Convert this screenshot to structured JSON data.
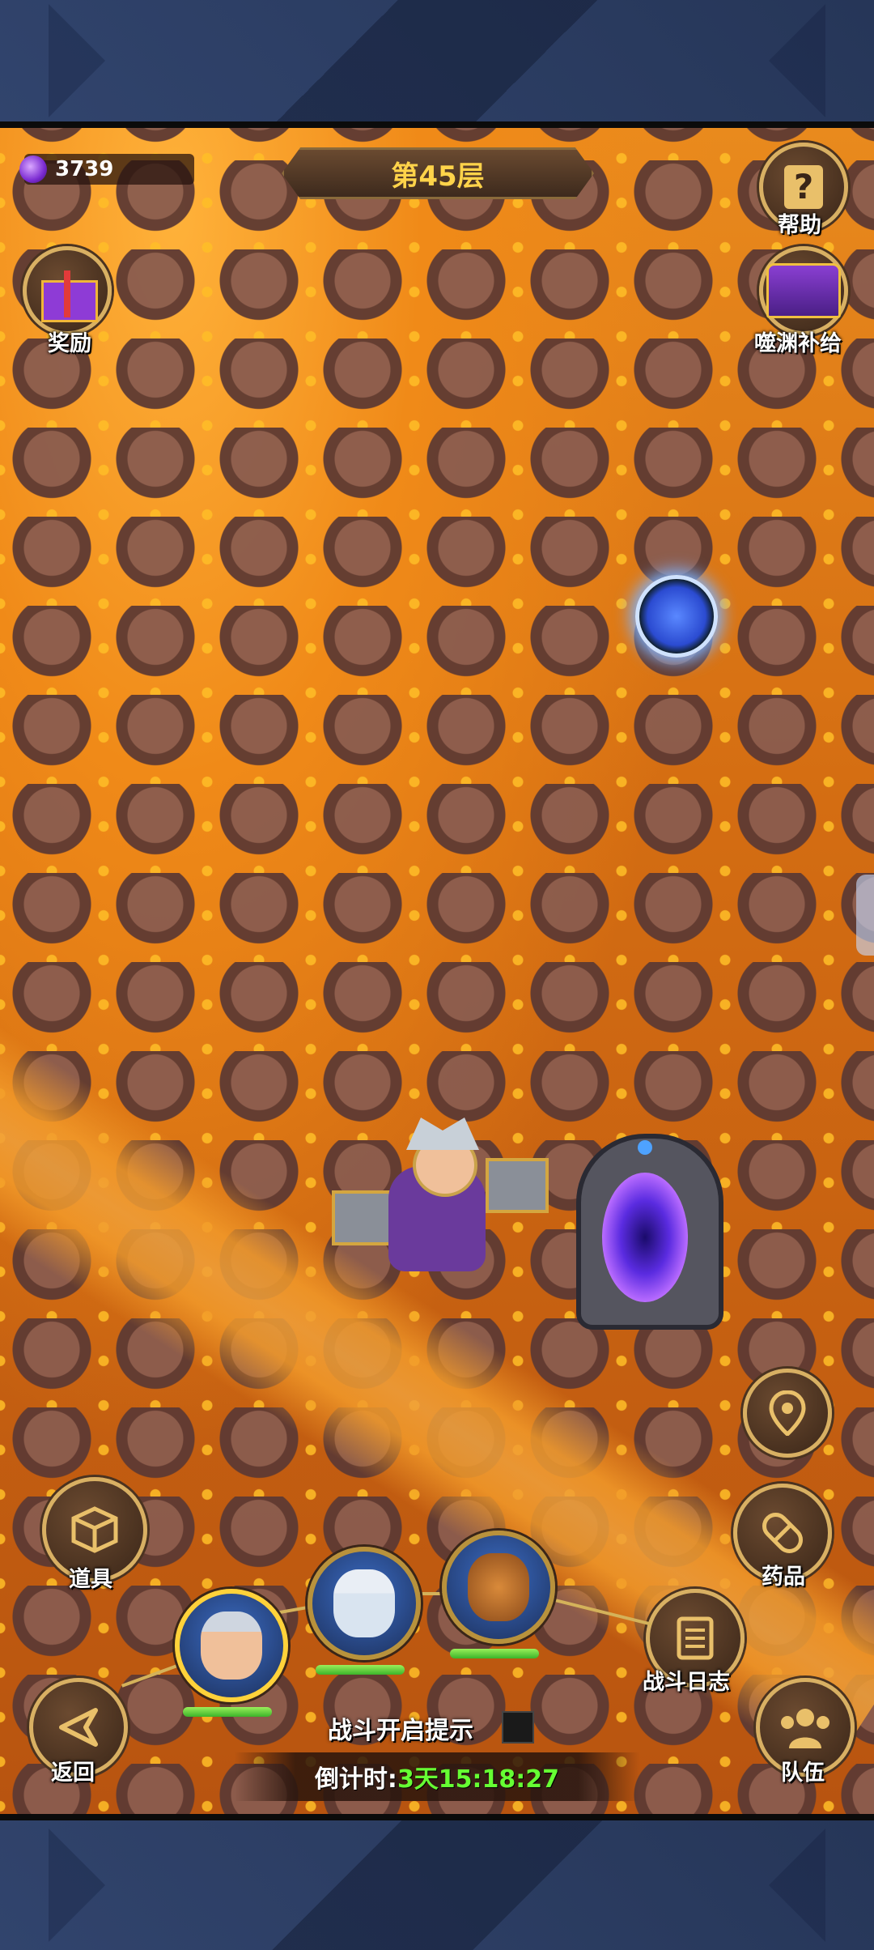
{
  "resource": {
    "icon": "purple-potion-icon",
    "amount": "3739"
  },
  "floor": {
    "title": "第45层"
  },
  "top_right": [
    {
      "label": "帮助",
      "icon": "question-icon"
    },
    {
      "label": "噬渊补给",
      "icon": "treasure-chest-icon"
    }
  ],
  "top_left": {
    "label": "奖励",
    "icon": "gift-icon"
  },
  "right_controls": {
    "locate_icon": "map-pin-icon",
    "potion_label": "药品",
    "battle_log_label": "战斗日志",
    "team_label": "队伍"
  },
  "left_controls": {
    "items_label": "道具",
    "back_label": "返回"
  },
  "heroes": [
    {
      "icon": "armored-warrior-portrait",
      "hp_fraction": 1.0,
      "selected": true
    },
    {
      "icon": "white-hair-mage-portrait",
      "hp_fraction": 1.0,
      "selected": false
    },
    {
      "icon": "lion-beast-portrait",
      "hp_fraction": 1.0,
      "selected": false
    }
  ],
  "battle_hint": {
    "label": "战斗开启提示",
    "checked": false
  },
  "countdown": {
    "label": "倒计时:",
    "value": "3天15:18:27"
  },
  "colors": {
    "lava": "#f08a18",
    "rock": "#8a5c4f",
    "gold_border": "#d8b063",
    "timer_green": "#66ff33"
  }
}
